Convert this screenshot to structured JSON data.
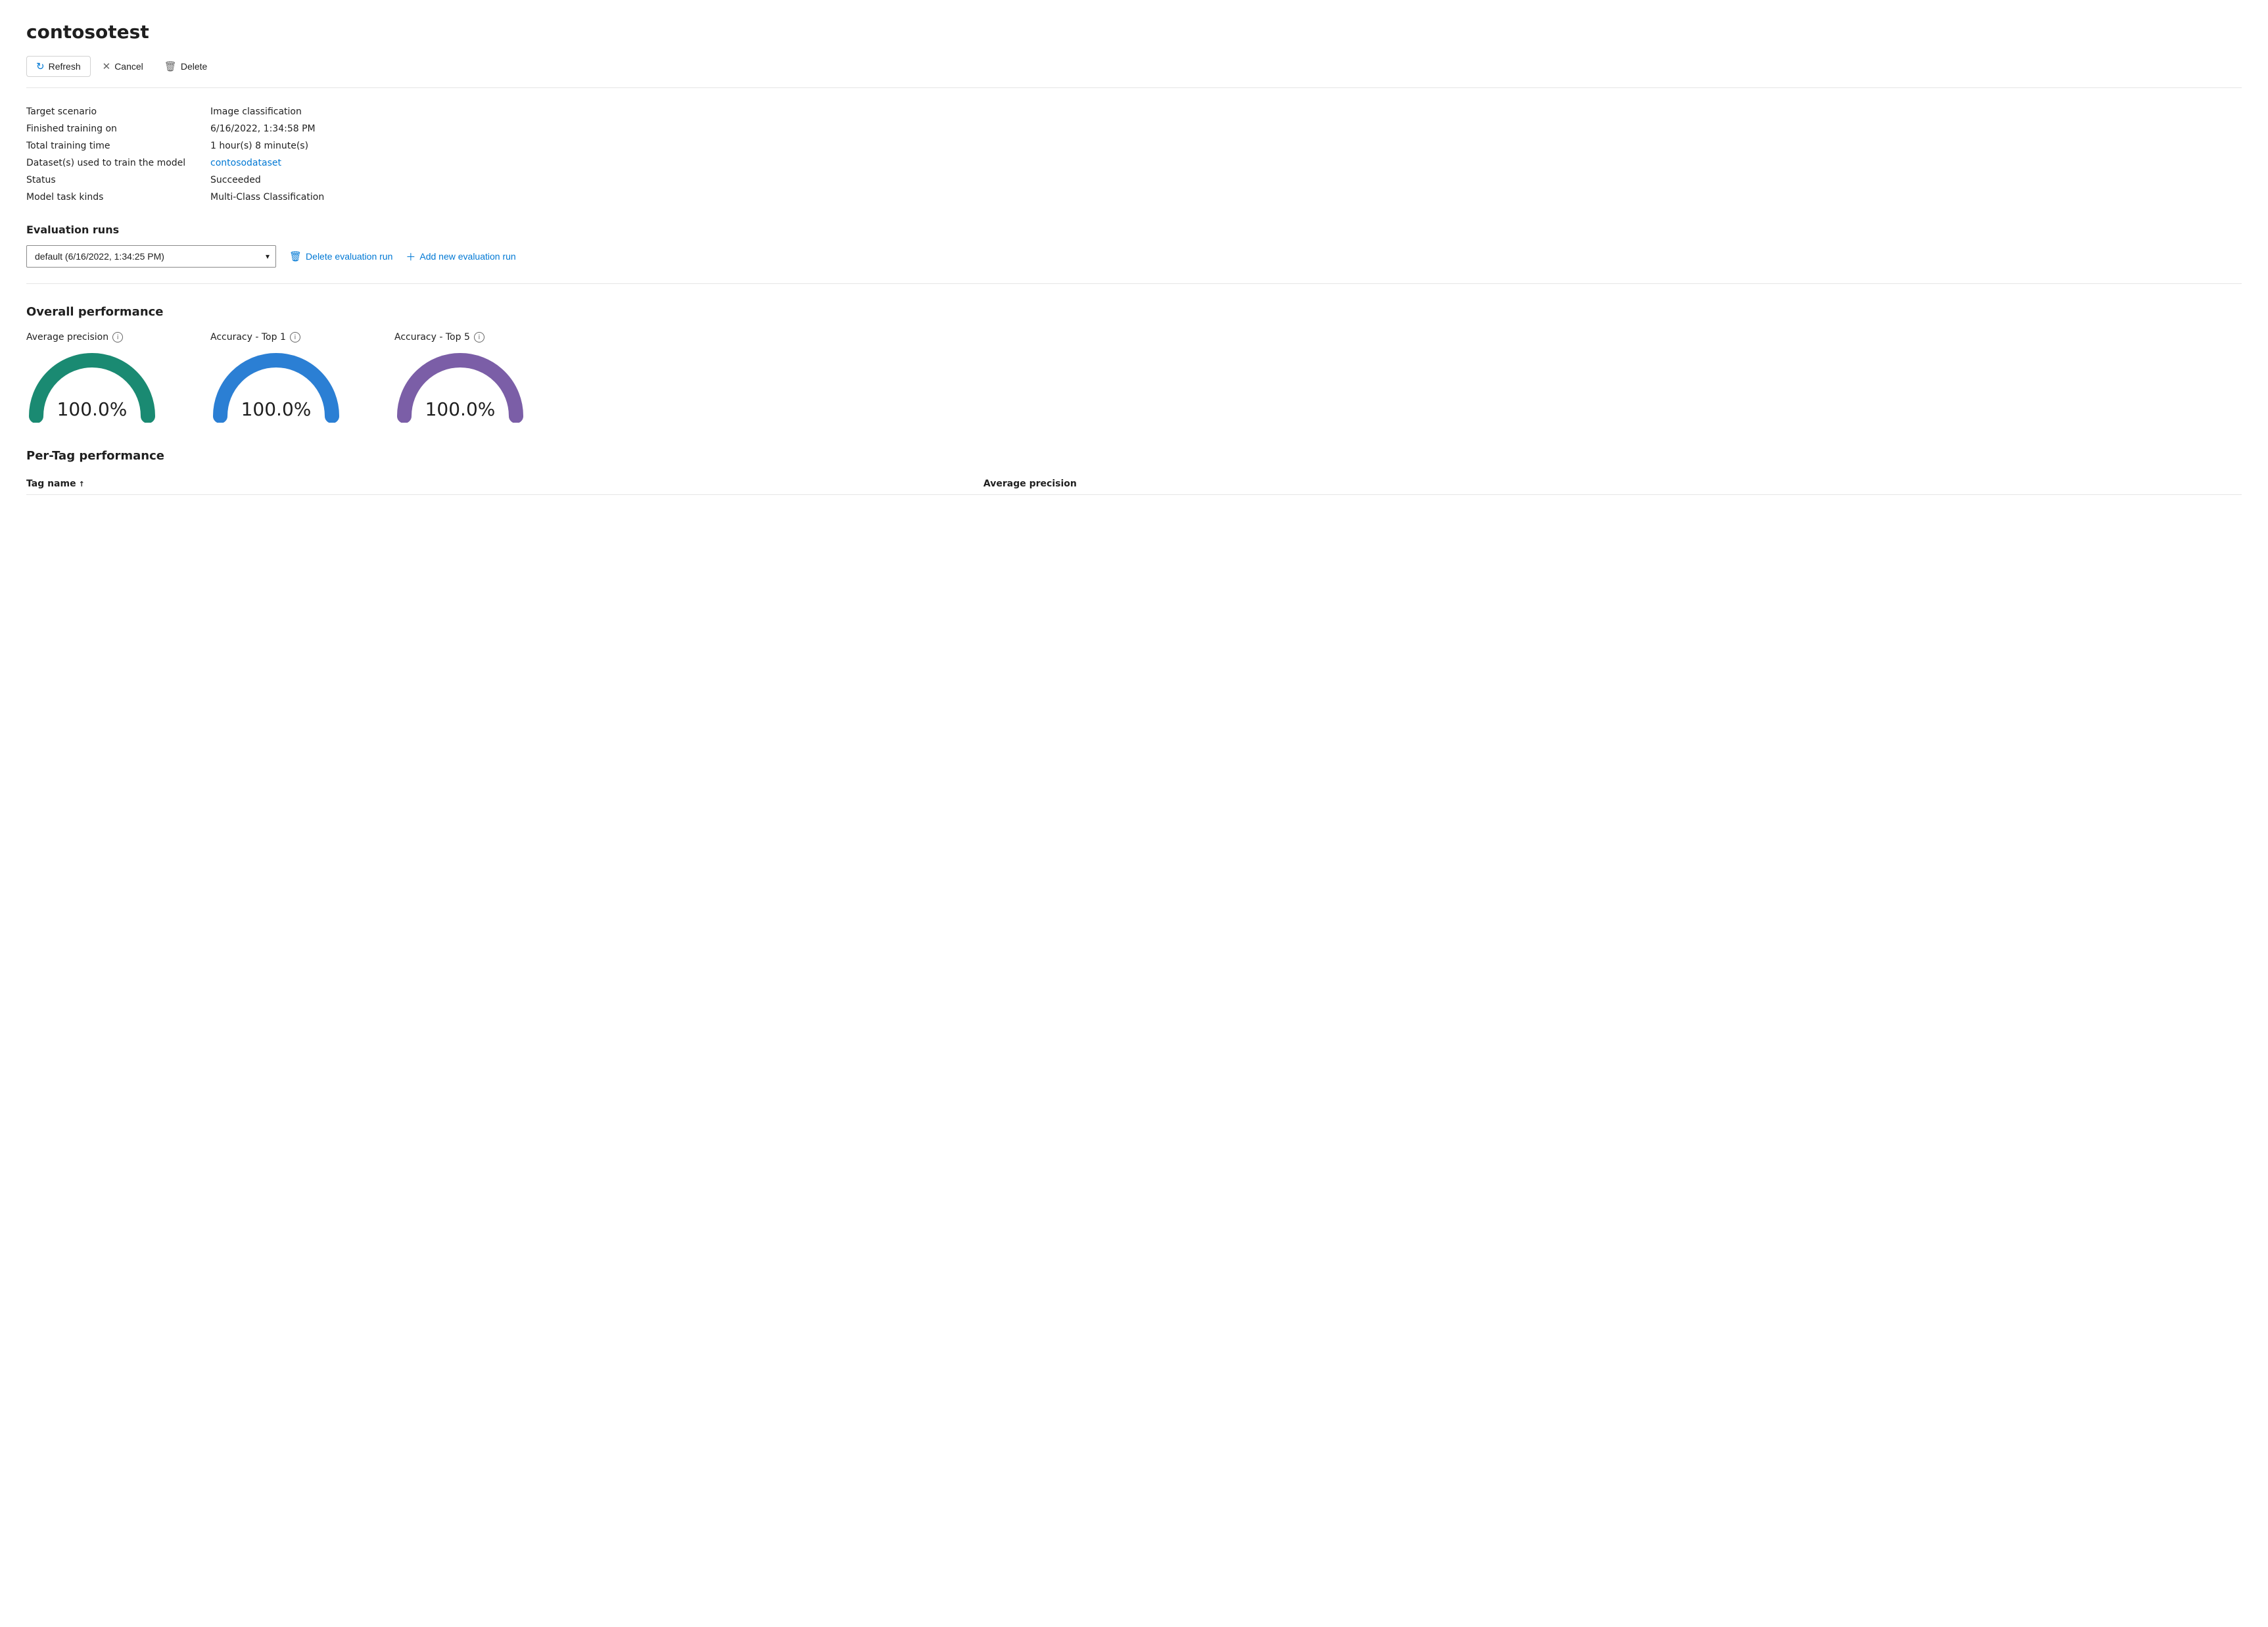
{
  "page": {
    "title": "contosotest"
  },
  "toolbar": {
    "refresh_label": "Refresh",
    "cancel_label": "Cancel",
    "delete_label": "Delete"
  },
  "info": {
    "target_scenario_label": "Target scenario",
    "target_scenario_value": "Image classification",
    "finished_training_label": "Finished training on",
    "finished_training_value": "6/16/2022, 1:34:58 PM",
    "total_training_label": "Total training time",
    "total_training_value": "1 hour(s) 8 minute(s)",
    "datasets_label": "Dataset(s) used to train the model",
    "datasets_value": "contosodataset",
    "status_label": "Status",
    "status_value": "Succeeded",
    "model_task_label": "Model task kinds",
    "model_task_value": "Multi-Class Classification"
  },
  "evaluation_runs": {
    "section_title": "Evaluation runs",
    "selected_option": "default (6/16/2022, 1:34:25 PM)",
    "options": [
      "default (6/16/2022, 1:34:25 PM)"
    ],
    "delete_btn_label": "Delete evaluation run",
    "add_btn_label": "Add new evaluation run"
  },
  "overall_performance": {
    "section_title": "Overall performance",
    "gauges": [
      {
        "label": "Average precision",
        "value": "100.0%",
        "color": "#1a8a72"
      },
      {
        "label": "Accuracy - Top 1",
        "value": "100.0%",
        "color": "#2b7fd4"
      },
      {
        "label": "Accuracy - Top 5",
        "value": "100.0%",
        "color": "#7b5ea7"
      }
    ]
  },
  "per_tag_performance": {
    "section_title": "Per-Tag performance",
    "columns": [
      {
        "label": "Tag name",
        "sort": "asc"
      },
      {
        "label": "Average precision",
        "sort": "none"
      }
    ]
  }
}
